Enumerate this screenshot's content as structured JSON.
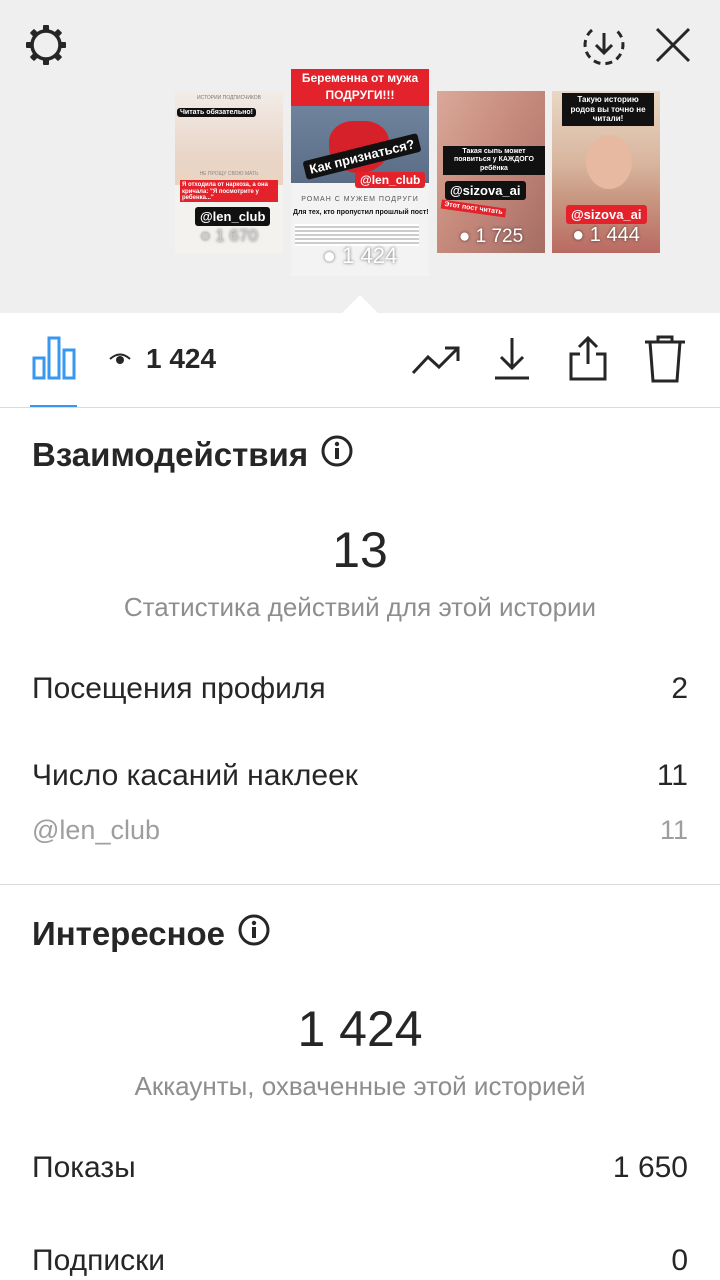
{
  "header": {
    "thumbnails": [
      {
        "top_caption": "ИСТОРИИ ПОДПИСЧИКОВ",
        "headline": "Читать обязательно!",
        "subtitle": "НЕ ПРОЩУ СВОЮ МАТЬ",
        "red_text": "Я отходила от наркоза, а она кричала: \"Я посмотрите у ребенка...\"",
        "tag": "@len_club",
        "views": "1 670"
      },
      {
        "headline_line1": "Беременна от мужа",
        "headline_line2": "ПОДРУГИ!!!",
        "question": "Как признаться?",
        "tag": "@len_club",
        "band": "РОМАН С МУЖЕМ ПОДРУГИ",
        "post_text": "Для тех, кто пропустил прошлый пост!",
        "views": "1 424"
      },
      {
        "red_text": "Такая сыпь может появиться у КАЖДОГО ребёнка",
        "tag": "@sizova_ai",
        "small_text": "Этот пост читать",
        "views": "1 725"
      },
      {
        "headline": "Такую историю родов вы точно не читали!",
        "tag": "@sizova_ai",
        "views": "1 444"
      }
    ]
  },
  "toolbar": {
    "views_count": "1 424"
  },
  "interactions": {
    "title": "Взаимодействия",
    "total": "13",
    "subtitle": "Статистика действий для этой истории",
    "rows": [
      {
        "label": "Посещения профиля",
        "value": "2"
      },
      {
        "label": "Число касаний наклеек",
        "value": "11"
      },
      {
        "label": "@len_club",
        "value": "11"
      }
    ]
  },
  "discovery": {
    "title": "Интересное",
    "total": "1 424",
    "subtitle": "Аккаунты, охваченные этой историей",
    "rows": [
      {
        "label": "Показы",
        "value": "1 650"
      },
      {
        "label": "Подписки",
        "value": "0"
      }
    ]
  },
  "colors": {
    "accent": "#3897f0",
    "header_bg": "#efefef",
    "text": "#262626",
    "muted": "#8e8e8e",
    "red": "#e3222b"
  },
  "icons": [
    "settings-icon",
    "download-circle-icon",
    "close-icon",
    "bar-chart-icon",
    "eye-icon",
    "trend-icon",
    "download-icon",
    "share-icon",
    "trash-icon",
    "info-icon"
  ]
}
